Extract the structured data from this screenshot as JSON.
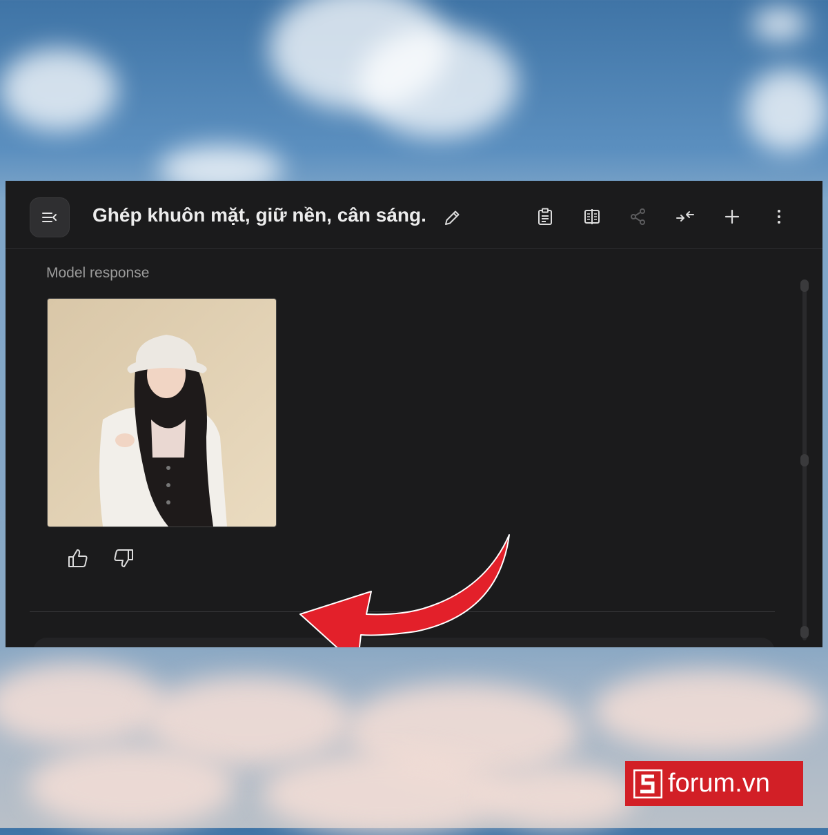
{
  "chat": {
    "title": "Ghép khuôn mặt, giữ nền, cân sáng.",
    "response_label": "Model response"
  },
  "toolbar": {
    "icons": [
      "clipboard-icon",
      "compare-icon",
      "share-icon",
      "collapse-icon",
      "plus-icon",
      "more-vertical-icon"
    ]
  },
  "watermark": {
    "text": "forum.vn",
    "logo_letter": "S"
  },
  "colors": {
    "window_bg": "#1b1b1c",
    "arrow": "#e3202a",
    "badge": "#d21f26",
    "title_text": "#ececec",
    "label_text": "#9c9c9c"
  }
}
